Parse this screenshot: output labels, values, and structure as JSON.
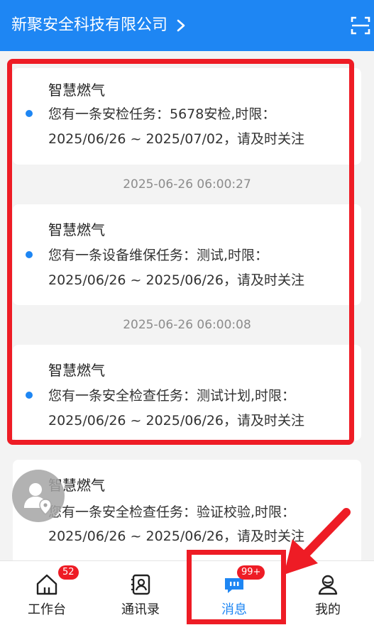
{
  "header": {
    "company": "新聚安全科技有限公司"
  },
  "messages": [
    {
      "timestamp": "",
      "source": "智慧燃气",
      "line1": "您有一条安检任务：5678安检,时限：",
      "line2": "2025/06/26 ~ 2025/07/02，请及时关注",
      "unread": true
    },
    {
      "timestamp": "2025-06-26 06:00:27",
      "source": "智慧燃气",
      "line1": "您有一条设备维保任务：测试,时限：",
      "line2": "2025/06/26 ~ 2025/06/26，请及时关注",
      "unread": true
    },
    {
      "timestamp": "2025-06-26 06:00:08",
      "source": "智慧燃气",
      "line1": "您有一条安全检查任务：测试计划,时限：",
      "line2": "2025/06/26 ~ 2025/06/26，请及时关注",
      "unread": true
    },
    {
      "timestamp": "",
      "source": "智慧燃气",
      "line1": "您有一条安全检查任务：验证校验,时限：",
      "line2": "2025/06/26 ~ 2025/06/26，请及时关注",
      "unread": false
    }
  ],
  "tabs": [
    {
      "label": "工作台",
      "badge": "52",
      "icon": "home-icon",
      "active": false
    },
    {
      "label": "通讯录",
      "badge": "",
      "icon": "contacts-icon",
      "active": false
    },
    {
      "label": "消息",
      "badge": "99+",
      "icon": "message-icon",
      "active": true
    },
    {
      "label": "我的",
      "badge": "",
      "icon": "user-icon",
      "active": false
    }
  ],
  "colors": {
    "brand": "#1e86f3",
    "highlight": "#ee1c25",
    "badge": "#ee1c25"
  }
}
